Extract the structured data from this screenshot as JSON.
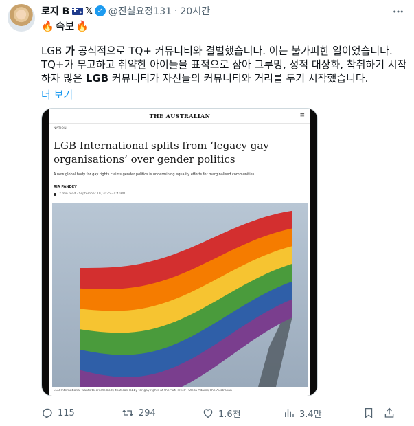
{
  "author": {
    "display_name": "로지 B",
    "handle": "@진실요정131",
    "separator": "·",
    "time": "20시간",
    "badge_x": "𝕏",
    "verified_glyph": "✓"
  },
  "tweet": {
    "breaking_emoji": "🔥",
    "breaking_label": "속보",
    "line1_a": "LGB ",
    "line1_bold": "가",
    "line1_b": " 공식적으로 TQ+ 커뮤니티와 결별했습니다. 이는 불가피한 일이었습니다.",
    "line2": "TQ+가 무고하고 취약한 아이들을 표적으로 삼아 그루밍, 성적 대상화, 착취하기 시작",
    "line3_a": "하자 많은 ",
    "line3_bold": "LGB",
    "line3_b": " 커뮤니티가 자신들의 커뮤니티와 거리를 두기 시작했습니다.",
    "show_more": "더 보기"
  },
  "article": {
    "masthead": "THE AUSTRALIAN",
    "menu_glyph": "≡",
    "section": "NATION",
    "headline": "LGB International splits from ‘legacy gay organisations’ over gender politics",
    "standfirst": "A new global body for gay rights claims gender politics is undermining equality efforts for marginalised communities.",
    "author": "RIA PANDEY",
    "meta": "2 min read · September 19, 2025 - 4:40PM",
    "caption": "LGB International wants to create body that can lobby for gay rights at the “UN level”. Stella Adams/The Australian"
  },
  "flag_colors": [
    "#d32f2f",
    "#f57c00",
    "#f6c431",
    "#4a9b3c",
    "#2f5fa8",
    "#7a3e8e"
  ],
  "actions": {
    "replies": "115",
    "retweets": "294",
    "likes": "1.6천",
    "views": "3.4만"
  },
  "icons": {
    "more": "more-horizontal-icon",
    "reply": "reply-icon",
    "retweet": "retweet-icon",
    "like": "heart-icon",
    "views": "views-bar-chart-icon",
    "bookmark": "bookmark-icon",
    "share": "share-icon"
  }
}
